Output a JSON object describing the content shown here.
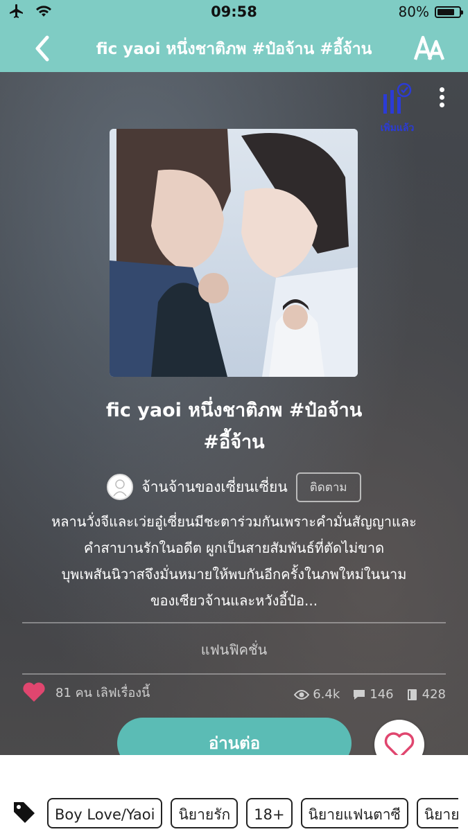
{
  "status_bar": {
    "time": "09:58",
    "battery": "80%",
    "battery_level": 0.8
  },
  "nav": {
    "title": "fic yaoi หนึ่งชาติภพ #ป๋อจ้าน #อี้จ้าน"
  },
  "library": {
    "added_label": "เพิ่มแล้ว"
  },
  "book": {
    "title_line1": "fic yaoi หนึ่งชาติภพ #ป๋อจ้าน",
    "title_line2": "#อี้จ้าน",
    "author": "จ้านจ้านของเซี่ยนเซี่ยน",
    "follow_label": "ติดตาม",
    "synopsis_lines": [
      "หลานวั่งจีและเว่ยอู๋เซี่ยนมีชะตาร่วมกันเพราะคำมั่นสัญญาและ",
      "คำสาบานรักในอดีต ผูกเป็นสายสัมพันธ์ที่ตัดไม่ขาด",
      "บุพเพสันนิวาสจึงมั่นหมายให้พบกันอีกครั้งในภพใหม่ในนาม",
      "ของเซียวจ้านและหวังอี้ป๋อ..."
    ],
    "genre": "แฟนฟิคชั่น",
    "love_text": "81 คน เลิฟเรื่องนี้",
    "views": "6.4k",
    "comments": "146",
    "chapters": "428",
    "read_button": "อ่านต่อ"
  },
  "tags": [
    "Boy Love/Yaoi",
    "นิยายรัก",
    "18+",
    "นิยายแฟนตาซี",
    "นิยาย"
  ],
  "colors": {
    "accent": "#7fccc4",
    "button": "#5bbcb5",
    "heart": "#e0466f",
    "added": "#2b3bd6"
  },
  "icons": [
    "airplane-icon",
    "wifi-icon",
    "battery-icon",
    "back-chevron-icon",
    "font-size-icon",
    "library-added-icon",
    "more-icon",
    "heart-icon",
    "eye-icon",
    "comment-icon",
    "book-icon",
    "heart-outline-icon",
    "tag-icon"
  ]
}
